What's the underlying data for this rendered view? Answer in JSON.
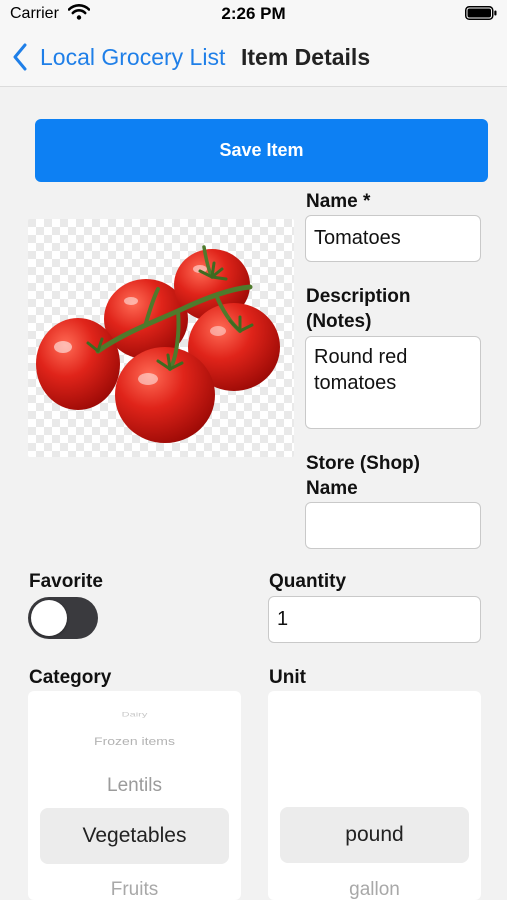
{
  "status_bar": {
    "carrier": "Carrier",
    "time": "2:26 PM"
  },
  "nav": {
    "back_label": "Local Grocery List",
    "title": "Item Details"
  },
  "save_button_label": "Save Item",
  "form": {
    "name": {
      "label": "Name *",
      "value": "Tomatoes"
    },
    "description": {
      "label_line1": "Description",
      "label_line2": "(Notes)",
      "value": "Round red\ntomatoes"
    },
    "store": {
      "label_line1": "Store (Shop)",
      "label_line2": "Name",
      "value": ""
    },
    "favorite": {
      "label": "Favorite",
      "enabled": false
    },
    "quantity": {
      "label": "Quantity",
      "value": "1"
    },
    "category": {
      "label": "Category",
      "options_above": [
        "Dairy",
        "Frozen items",
        "Lentils"
      ],
      "selected": "Vegetables",
      "options_below": [
        "Fruits"
      ]
    },
    "unit": {
      "label": "Unit",
      "selected": "pound",
      "options_below": [
        "gallon"
      ]
    }
  },
  "icons": {
    "back": "chevron-left-icon",
    "wifi": "wifi-icon",
    "battery": "battery-icon",
    "image": "tomatoes-image"
  },
  "colors": {
    "accent": "#1f7fe8",
    "button": "#0d80f3",
    "toggle_off": "#3a3a3e"
  }
}
